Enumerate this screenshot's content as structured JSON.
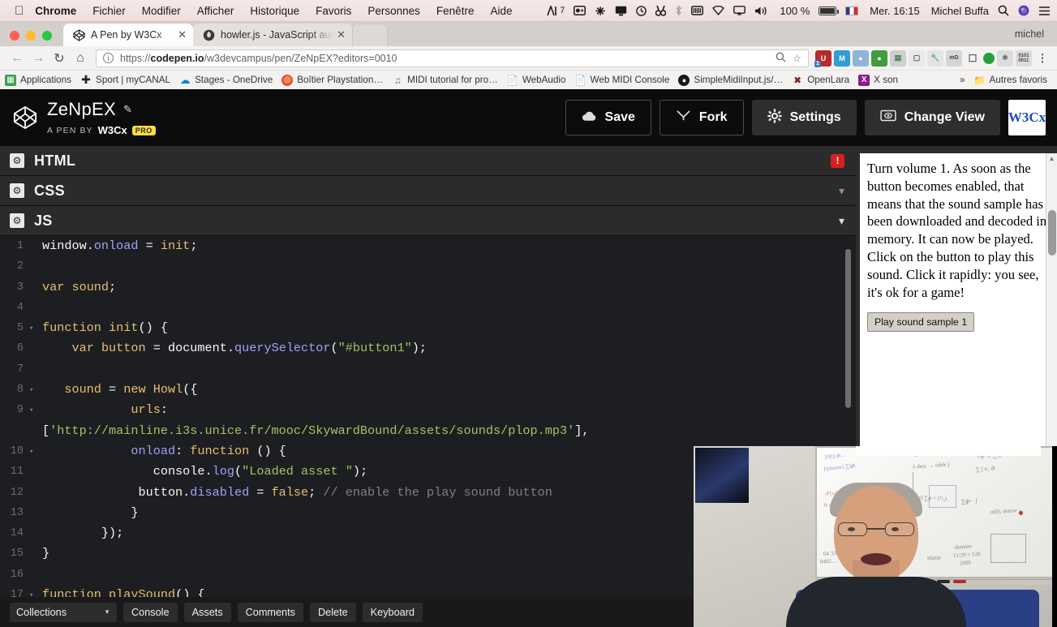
{
  "macbar": {
    "apple_icon": "apple-icon",
    "items": [
      {
        "label": "Chrome",
        "bold": true
      },
      {
        "label": "Fichier",
        "bold": false
      },
      {
        "label": "Modifier",
        "bold": false
      },
      {
        "label": "Afficher",
        "bold": false
      },
      {
        "label": "Historique",
        "bold": false
      },
      {
        "label": "Favoris",
        "bold": false
      },
      {
        "label": "Personnes",
        "bold": false
      },
      {
        "label": "Fenêtre",
        "bold": false
      },
      {
        "label": "Aide",
        "bold": false
      }
    ],
    "status_icons": [
      "audio-meter-icon",
      "screen-record-icon",
      "dropbox-icon",
      "display-icon",
      "time-machine-icon",
      "search-tool-icon",
      "bluetooth-icon",
      "keyboard-brightness-icon",
      "wifi-icon",
      "airplay-icon",
      "volume-icon"
    ],
    "audio_meter_number": "7",
    "battery_percent": "100 %",
    "battery_icon": "battery-charging-icon",
    "flag": "flag-fr-icon",
    "datetime": "Mer. 16:15",
    "user": "Michel Buffa",
    "spotlight_icon": "search-icon",
    "siri_icon": "siri-icon",
    "notification_icon": "notification-center-icon"
  },
  "chrome": {
    "tabs": [
      {
        "title": "A Pen by W3Cx",
        "favicon": "codepen-icon",
        "active": true
      },
      {
        "title": "howler.js - JavaScript audio lib",
        "favicon": "howler-icon",
        "active": false
      }
    ],
    "new_tab_label": "+",
    "profile_name": "michel",
    "nav": {
      "back": "back-arrow-icon",
      "forward": "forward-arrow-icon",
      "reload": "reload-icon",
      "home": "home-icon"
    },
    "omnibox": {
      "info_icon": "page-info-icon",
      "url_prefix": "https://",
      "url_domain": "codepen.io",
      "url_path": "/w3devcampus/pen/ZeNpEX?editors=0010",
      "zoom_icon": "search-zoom-icon",
      "bookmark_icon": "star-icon"
    },
    "extensions": [
      "ublock-icon",
      "momentum-icon",
      "pocket-icon",
      "octotree-icon",
      "spreadsheet-icon",
      "cube-icon",
      "wrench-icon",
      "markdown-icon",
      "cast-icon",
      "avatar-icon",
      "react-devtools-icon",
      "binary-icon",
      "menu-icon"
    ],
    "extension_badge": "1",
    "bookmarks": [
      {
        "label": "Applications",
        "icon": "apps-grid-icon",
        "color": "#3ba14e"
      },
      {
        "label": "Sport | myCANAL",
        "icon": "plus-icon",
        "color": "#222222"
      },
      {
        "label": "Stages - OneDrive",
        "icon": "onedrive-cloud-icon",
        "color": "#0a84d8"
      },
      {
        "label": "Boîtier Playstation…",
        "icon": "playstation-icon",
        "color": "#e8502a"
      },
      {
        "label": "MIDI tutorial for pro…",
        "icon": "music-note-icon",
        "color": "#8a8a90"
      },
      {
        "label": "WebAudio",
        "icon": "page-icon",
        "color": "#8a8a90"
      },
      {
        "label": "Web MIDI Console",
        "icon": "page-icon",
        "color": "#8a8a90"
      },
      {
        "label": "SimpleMidiInput.js/…",
        "icon": "github-icon",
        "color": "#181818"
      },
      {
        "label": "OpenLara",
        "icon": "openlara-icon",
        "color": "#7d1f1f"
      },
      {
        "label": "X son",
        "icon": "x-icon",
        "color": "#8b1b8b"
      }
    ],
    "bookmarks_overflow": "»",
    "other_bookmarks": {
      "label": "Autres favoris",
      "icon": "folder-icon"
    }
  },
  "codepen": {
    "logo_icon": "codepen-logo-icon",
    "pen_title": "ZeNpEX",
    "edit_icon": "pencil-icon",
    "byline": "A PEN BY",
    "author": "W3Cx",
    "pro_badge": "PRO",
    "actions": [
      {
        "label": "Save",
        "icon": "cloud-icon",
        "style": "dark"
      },
      {
        "label": "Fork",
        "icon": "fork-icon",
        "style": "dark"
      },
      {
        "label": "Settings",
        "icon": "gear-icon",
        "style": "grey"
      },
      {
        "label": "Change View",
        "icon": "view-icon",
        "style": "grey"
      }
    ],
    "brand_logo": "W3Cx",
    "panels": [
      {
        "name": "HTML",
        "gear_icon": "gear-icon",
        "state_icon": "error-icon",
        "collapsed": true
      },
      {
        "name": "CSS",
        "gear_icon": "gear-icon",
        "state_icon": "chevron-down-icon",
        "collapsed": true
      },
      {
        "name": "JS",
        "gear_icon": "gear-icon",
        "state_icon": "chevron-down-icon",
        "collapsed": false
      }
    ],
    "bottom_bar": {
      "collections_label": "Collections",
      "collections_caret": "chevron-down-icon",
      "buttons": [
        "Console",
        "Assets",
        "Comments",
        "Delete",
        "Keyboard"
      ]
    }
  },
  "code": {
    "language": "JS",
    "lines": [
      {
        "n": "1",
        "fold": "",
        "tokens": [
          {
            "t": "window",
            "c": "t-obj"
          },
          {
            "t": ".",
            "c": "t-punc"
          },
          {
            "t": "onload",
            "c": "t-prop"
          },
          {
            "t": " = ",
            "c": "t-punc"
          },
          {
            "t": "init",
            "c": "t-kw"
          },
          {
            "t": ";",
            "c": "t-punc"
          }
        ]
      },
      {
        "n": "2",
        "fold": "",
        "tokens": []
      },
      {
        "n": "3",
        "fold": "",
        "tokens": [
          {
            "t": "var",
            "c": "t-kw"
          },
          {
            "t": " ",
            "c": "t-punc"
          },
          {
            "t": "sound",
            "c": "t-kw"
          },
          {
            "t": ";",
            "c": "t-punc"
          }
        ]
      },
      {
        "n": "4",
        "fold": "",
        "tokens": []
      },
      {
        "n": "5",
        "fold": "▾",
        "tokens": [
          {
            "t": "function",
            "c": "t-kw"
          },
          {
            "t": " ",
            "c": "t-punc"
          },
          {
            "t": "init",
            "c": "t-kw"
          },
          {
            "t": "() {",
            "c": "t-punc"
          }
        ]
      },
      {
        "n": "6",
        "fold": "",
        "tokens": [
          {
            "t": "    ",
            "c": "t-punc"
          },
          {
            "t": "var",
            "c": "t-kw"
          },
          {
            "t": " ",
            "c": "t-punc"
          },
          {
            "t": "button",
            "c": "t-kw"
          },
          {
            "t": " = ",
            "c": "t-punc"
          },
          {
            "t": "document",
            "c": "t-obj"
          },
          {
            "t": ".",
            "c": "t-punc"
          },
          {
            "t": "querySelector",
            "c": "t-prop"
          },
          {
            "t": "(",
            "c": "t-punc"
          },
          {
            "t": "\"#button1\"",
            "c": "t-str"
          },
          {
            "t": ");",
            "c": "t-punc"
          }
        ]
      },
      {
        "n": "7",
        "fold": "",
        "tokens": []
      },
      {
        "n": "8",
        "fold": "▾",
        "tokens": [
          {
            "t": "   ",
            "c": "t-punc"
          },
          {
            "t": "sound",
            "c": "t-kw"
          },
          {
            "t": " = ",
            "c": "t-punc"
          },
          {
            "t": "new",
            "c": "t-kw"
          },
          {
            "t": " ",
            "c": "t-punc"
          },
          {
            "t": "Howl",
            "c": "t-kw"
          },
          {
            "t": "({",
            "c": "t-punc"
          }
        ]
      },
      {
        "n": "9",
        "fold": "▾",
        "tokens": [
          {
            "t": "            ",
            "c": "t-punc"
          },
          {
            "t": "urls",
            "c": "t-kw"
          },
          {
            "t": ":",
            "c": "t-punc"
          }
        ]
      },
      {
        "n": "",
        "fold": "",
        "tokens": [
          {
            "t": "[",
            "c": "t-punc"
          },
          {
            "t": "'http://mainline.i3s.unice.fr/mooc/SkywardBound/assets/sounds/plop.mp3'",
            "c": "t-str"
          },
          {
            "t": "],",
            "c": "t-punc"
          }
        ]
      },
      {
        "n": "10",
        "fold": "▾",
        "tokens": [
          {
            "t": "            ",
            "c": "t-punc"
          },
          {
            "t": "onload",
            "c": "t-prop"
          },
          {
            "t": ": ",
            "c": "t-punc"
          },
          {
            "t": "function",
            "c": "t-kw"
          },
          {
            "t": " () {",
            "c": "t-punc"
          }
        ]
      },
      {
        "n": "11",
        "fold": "",
        "tokens": [
          {
            "t": "               ",
            "c": "t-punc"
          },
          {
            "t": "console",
            "c": "t-obj"
          },
          {
            "t": ".",
            "c": "t-punc"
          },
          {
            "t": "log",
            "c": "t-prop"
          },
          {
            "t": "(",
            "c": "t-punc"
          },
          {
            "t": "\"Loaded asset \"",
            "c": "t-str"
          },
          {
            "t": ");",
            "c": "t-punc"
          }
        ]
      },
      {
        "n": "12",
        "fold": "",
        "tokens": [
          {
            "t": "             ",
            "c": "t-punc"
          },
          {
            "t": "button",
            "c": "t-obj"
          },
          {
            "t": ".",
            "c": "t-punc"
          },
          {
            "t": "disabled",
            "c": "t-prop"
          },
          {
            "t": " = ",
            "c": "t-punc"
          },
          {
            "t": "false",
            "c": "t-kw"
          },
          {
            "t": "; ",
            "c": "t-punc"
          },
          {
            "t": "// enable the play sound button",
            "c": "t-com"
          }
        ]
      },
      {
        "n": "13",
        "fold": "",
        "tokens": [
          {
            "t": "            }",
            "c": "t-punc"
          }
        ]
      },
      {
        "n": "14",
        "fold": "",
        "tokens": [
          {
            "t": "        });",
            "c": "t-punc"
          }
        ]
      },
      {
        "n": "15",
        "fold": "",
        "tokens": [
          {
            "t": "}",
            "c": "t-punc"
          }
        ]
      },
      {
        "n": "16",
        "fold": "",
        "tokens": []
      },
      {
        "n": "17",
        "fold": "▾",
        "tokens": [
          {
            "t": "function",
            "c": "t-kw"
          },
          {
            "t": " ",
            "c": "t-punc"
          },
          {
            "t": "playSound",
            "c": "t-kw"
          },
          {
            "t": "() {",
            "c": "t-punc"
          }
        ]
      }
    ]
  },
  "preview": {
    "body_text": "Turn volume 1. As soon as the button becomes enabled, that means that the sound sample has been downloaded and decoded in memory. It can now be played. Click on the button to play this sound. Click it rapidly: you see, it's ok for a game!",
    "button_label": "Play sound sample 1",
    "scroll_up_icon": "scroll-up-icon"
  },
  "webcam": {
    "description": "presenter-video-overlay"
  }
}
